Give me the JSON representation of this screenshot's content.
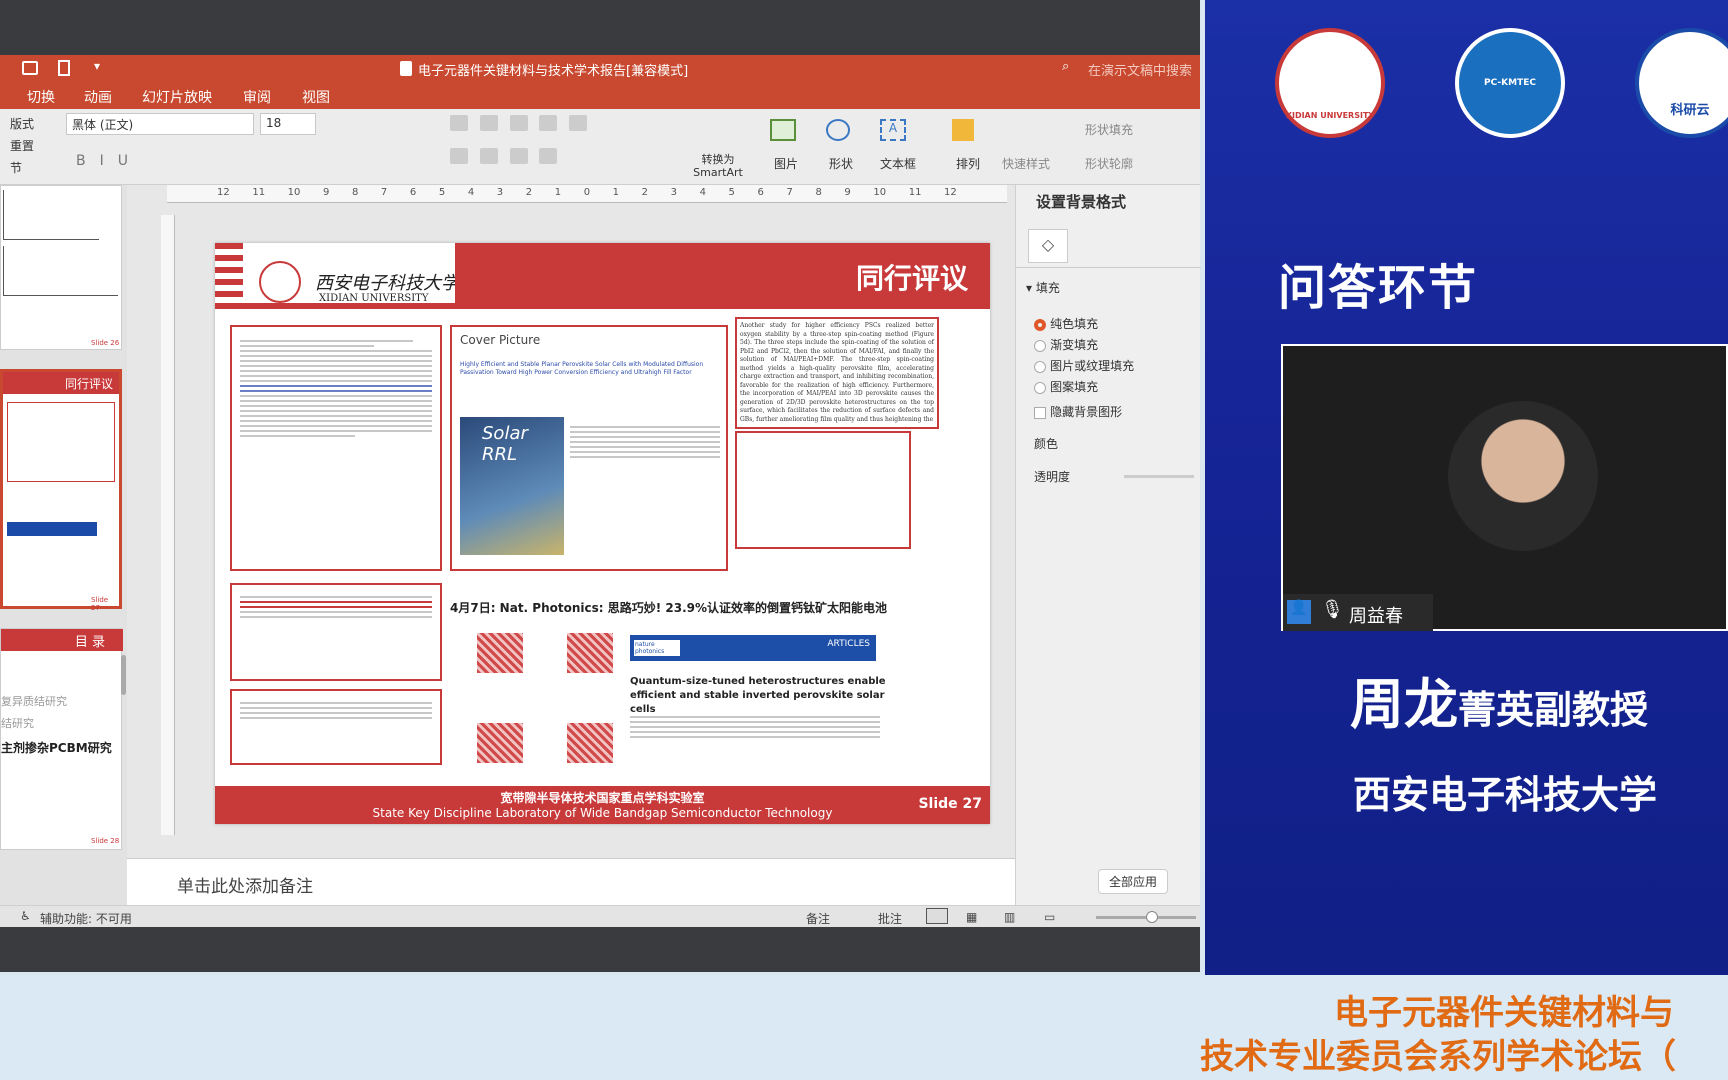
{
  "window": {
    "doc_title": "电子元器件关键材料与技术学术报告[兼容模式]",
    "search_placeholder": "在演示文稿中搜索"
  },
  "menu": [
    "切换",
    "动画",
    "幻灯片放映",
    "审阅",
    "视图"
  ],
  "ribbon": {
    "layout": "版式",
    "reset": "重置",
    "section": "节",
    "font_name": "黑体 (正文)",
    "font_size": "18",
    "picture": "图片",
    "shape": "形状",
    "textbox": "文本框",
    "arrange": "排列",
    "quick_style": "快速样式",
    "convert_smartart": "转换为 SmartArt",
    "shape_fill": "形状填充",
    "shape_outline": "形状轮廓"
  },
  "thumbs": [
    {
      "title": "同行评议",
      "slide": "Slide 27"
    },
    {
      "title": "目 录",
      "slide": "Slide 28"
    }
  ],
  "thumb_side_text": [
    "复异质结研究",
    "结研究",
    "主剂掺杂PCBM研究",
    "Slide 26",
    "Slide 27",
    "Slide 28"
  ],
  "ruler_numbers": [
    "12",
    "11",
    "10",
    "9",
    "8",
    "7",
    "6",
    "5",
    "4",
    "3",
    "2",
    "1",
    "0",
    "1",
    "2",
    "3",
    "4",
    "5",
    "6",
    "7",
    "8",
    "9",
    "10",
    "11",
    "12"
  ],
  "slide": {
    "university_cn": "西安电子科技大学",
    "university_en": "XIDIAN UNIVERSITY",
    "header": "同行评议",
    "cover_picture": "Cover Picture",
    "cover_article": "Highly Efficient and Stable Planar Perovskite Solar Cells with Modulated Diffusion Passivation Toward High Power Conversion Efficiency and Ultrahigh Fill Factor",
    "solar_rrl": "Solar RRL",
    "right_text": "Another study for higher efficiency PSCs realized better oxygen stability by a three-step spin-coating method (Figure 5d). The three steps include the spin-coating of the solution of PbI2 and PbCl2, then the solution of MAI/FAI, and finally the solution of MAI/PEAI+DMF. The three-step spin-coating method yields a high-quality perovskite film, accelerating charge extraction and transport, and inhibiting recombination, favorable for the realization of high efficiency. Furthermore, the incorporation of MAI/PEAI into 3D perovskite causes the generation of 2D/3D perovskite heterostructures on the top surface, which facilitates the reduction of surface defects and GBs, further ameliorating film quality and thus heightening the",
    "photonics_line": "4月7日: Nat. Photonics: 思路巧妙! 23.9%认证效率的倒置钙钛矿太阳能电池",
    "nature_label": "nature photonics",
    "articles": "ARTICLES",
    "np_title": "Quantum-size-tuned heterostructures enable efficient and stable inverted perovskite solar cells",
    "footer_cn": "宽带隙半导体技术国家重点学科实验室",
    "footer_en": "State Key Discipline Laboratory of Wide Bandgap Semiconductor Technology",
    "slide_num": "Slide 27"
  },
  "notes_placeholder": "单击此处添加备注",
  "panel": {
    "title": "设置背景格式",
    "fill": "填充",
    "options": [
      "纯色填充",
      "渐变填充",
      "图片或纹理填充",
      "图案填充"
    ],
    "hide_bg": "隐藏背景图形",
    "color": "颜色",
    "transparency": "透明度",
    "apply_all": "全部应用"
  },
  "status": {
    "accessibility": "辅助功能: 不可用",
    "notes": "备注",
    "comments": "批注"
  },
  "blue_panel": {
    "qa": "问答环节",
    "speaker_name_tag": "周益春",
    "name": "周龙",
    "title_suffix": "菁英副教授",
    "affiliation": "西安电子科技大学",
    "logo1_text": "XIDIAN UNIVERSITY",
    "logo2_text": "PC-KMTEC",
    "logo3_text": "科研云"
  },
  "banner": {
    "line1": "电子元器件关键材料与",
    "line2": "技术专业委员会系列学术论坛（"
  },
  "colors": {
    "ppt_red": "#c8492f",
    "slide_red": "#c8393a",
    "blue_bg": "#1a2ba0",
    "banner_orange": "#e06b14"
  }
}
